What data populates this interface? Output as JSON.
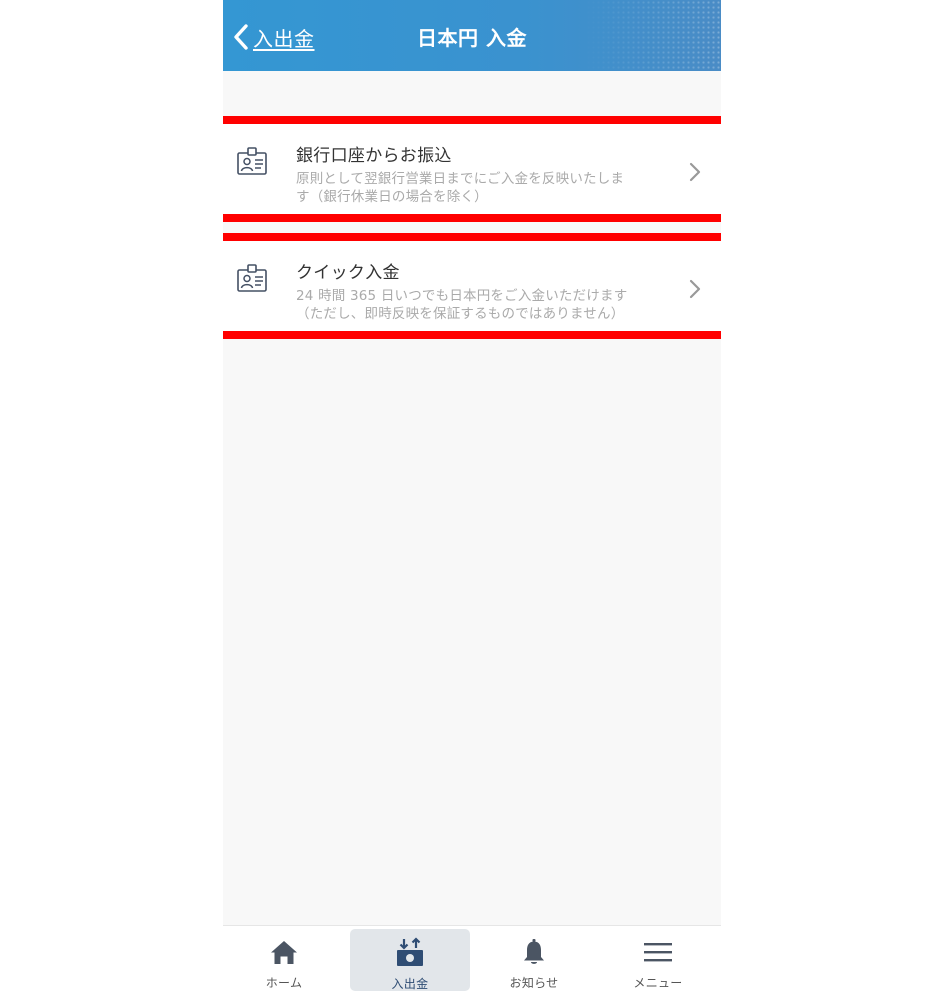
{
  "header": {
    "back_label": "入出金",
    "title": "日本円 入金"
  },
  "options": [
    {
      "title": "銀行口座からお振込",
      "description_line1": "原則として翌銀行営業日までにご入金を反映いたしま",
      "description_line2": "す（銀行休業日の場合を除く）",
      "icon": "id-card-icon"
    },
    {
      "title": "クイック入金",
      "description_line1": "24 時間 365 日いつでも日本円をご入金いただけます",
      "description_line2": "（ただし、即時反映を保証するものではありません）",
      "icon": "id-card-icon"
    }
  ],
  "tabbar": {
    "items": [
      {
        "label": "ホーム",
        "icon": "home-icon",
        "active": false
      },
      {
        "label": "入出金",
        "icon": "deposit-withdraw-icon",
        "active": true
      },
      {
        "label": "お知らせ",
        "icon": "bell-icon",
        "active": false
      },
      {
        "label": "メニュー",
        "icon": "menu-icon",
        "active": false
      }
    ]
  },
  "colors": {
    "header": "#3497d3",
    "highlight_border": "#ff0000",
    "background": "#f8f8f8",
    "active_tab": "#e2e6ea",
    "icon_dark": "#445064"
  }
}
